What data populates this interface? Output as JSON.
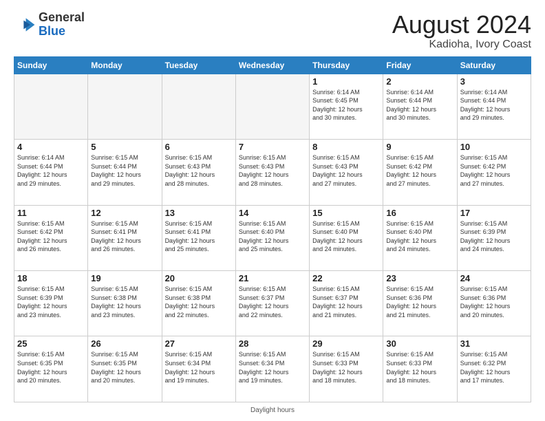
{
  "header": {
    "logo_general": "General",
    "logo_blue": "Blue",
    "month_title": "August 2024",
    "location": "Kadioha, Ivory Coast"
  },
  "footer": {
    "daylight_label": "Daylight hours"
  },
  "days_of_week": [
    "Sunday",
    "Monday",
    "Tuesday",
    "Wednesday",
    "Thursday",
    "Friday",
    "Saturday"
  ],
  "weeks": [
    [
      {
        "day": "",
        "info": ""
      },
      {
        "day": "",
        "info": ""
      },
      {
        "day": "",
        "info": ""
      },
      {
        "day": "",
        "info": ""
      },
      {
        "day": "1",
        "info": "Sunrise: 6:14 AM\nSunset: 6:45 PM\nDaylight: 12 hours\nand 30 minutes."
      },
      {
        "day": "2",
        "info": "Sunrise: 6:14 AM\nSunset: 6:44 PM\nDaylight: 12 hours\nand 30 minutes."
      },
      {
        "day": "3",
        "info": "Sunrise: 6:14 AM\nSunset: 6:44 PM\nDaylight: 12 hours\nand 29 minutes."
      }
    ],
    [
      {
        "day": "4",
        "info": "Sunrise: 6:14 AM\nSunset: 6:44 PM\nDaylight: 12 hours\nand 29 minutes."
      },
      {
        "day": "5",
        "info": "Sunrise: 6:15 AM\nSunset: 6:44 PM\nDaylight: 12 hours\nand 29 minutes."
      },
      {
        "day": "6",
        "info": "Sunrise: 6:15 AM\nSunset: 6:43 PM\nDaylight: 12 hours\nand 28 minutes."
      },
      {
        "day": "7",
        "info": "Sunrise: 6:15 AM\nSunset: 6:43 PM\nDaylight: 12 hours\nand 28 minutes."
      },
      {
        "day": "8",
        "info": "Sunrise: 6:15 AM\nSunset: 6:43 PM\nDaylight: 12 hours\nand 27 minutes."
      },
      {
        "day": "9",
        "info": "Sunrise: 6:15 AM\nSunset: 6:42 PM\nDaylight: 12 hours\nand 27 minutes."
      },
      {
        "day": "10",
        "info": "Sunrise: 6:15 AM\nSunset: 6:42 PM\nDaylight: 12 hours\nand 27 minutes."
      }
    ],
    [
      {
        "day": "11",
        "info": "Sunrise: 6:15 AM\nSunset: 6:42 PM\nDaylight: 12 hours\nand 26 minutes."
      },
      {
        "day": "12",
        "info": "Sunrise: 6:15 AM\nSunset: 6:41 PM\nDaylight: 12 hours\nand 26 minutes."
      },
      {
        "day": "13",
        "info": "Sunrise: 6:15 AM\nSunset: 6:41 PM\nDaylight: 12 hours\nand 25 minutes."
      },
      {
        "day": "14",
        "info": "Sunrise: 6:15 AM\nSunset: 6:40 PM\nDaylight: 12 hours\nand 25 minutes."
      },
      {
        "day": "15",
        "info": "Sunrise: 6:15 AM\nSunset: 6:40 PM\nDaylight: 12 hours\nand 24 minutes."
      },
      {
        "day": "16",
        "info": "Sunrise: 6:15 AM\nSunset: 6:40 PM\nDaylight: 12 hours\nand 24 minutes."
      },
      {
        "day": "17",
        "info": "Sunrise: 6:15 AM\nSunset: 6:39 PM\nDaylight: 12 hours\nand 24 minutes."
      }
    ],
    [
      {
        "day": "18",
        "info": "Sunrise: 6:15 AM\nSunset: 6:39 PM\nDaylight: 12 hours\nand 23 minutes."
      },
      {
        "day": "19",
        "info": "Sunrise: 6:15 AM\nSunset: 6:38 PM\nDaylight: 12 hours\nand 23 minutes."
      },
      {
        "day": "20",
        "info": "Sunrise: 6:15 AM\nSunset: 6:38 PM\nDaylight: 12 hours\nand 22 minutes."
      },
      {
        "day": "21",
        "info": "Sunrise: 6:15 AM\nSunset: 6:37 PM\nDaylight: 12 hours\nand 22 minutes."
      },
      {
        "day": "22",
        "info": "Sunrise: 6:15 AM\nSunset: 6:37 PM\nDaylight: 12 hours\nand 21 minutes."
      },
      {
        "day": "23",
        "info": "Sunrise: 6:15 AM\nSunset: 6:36 PM\nDaylight: 12 hours\nand 21 minutes."
      },
      {
        "day": "24",
        "info": "Sunrise: 6:15 AM\nSunset: 6:36 PM\nDaylight: 12 hours\nand 20 minutes."
      }
    ],
    [
      {
        "day": "25",
        "info": "Sunrise: 6:15 AM\nSunset: 6:35 PM\nDaylight: 12 hours\nand 20 minutes."
      },
      {
        "day": "26",
        "info": "Sunrise: 6:15 AM\nSunset: 6:35 PM\nDaylight: 12 hours\nand 20 minutes."
      },
      {
        "day": "27",
        "info": "Sunrise: 6:15 AM\nSunset: 6:34 PM\nDaylight: 12 hours\nand 19 minutes."
      },
      {
        "day": "28",
        "info": "Sunrise: 6:15 AM\nSunset: 6:34 PM\nDaylight: 12 hours\nand 19 minutes."
      },
      {
        "day": "29",
        "info": "Sunrise: 6:15 AM\nSunset: 6:33 PM\nDaylight: 12 hours\nand 18 minutes."
      },
      {
        "day": "30",
        "info": "Sunrise: 6:15 AM\nSunset: 6:33 PM\nDaylight: 12 hours\nand 18 minutes."
      },
      {
        "day": "31",
        "info": "Sunrise: 6:15 AM\nSunset: 6:32 PM\nDaylight: 12 hours\nand 17 minutes."
      }
    ]
  ]
}
